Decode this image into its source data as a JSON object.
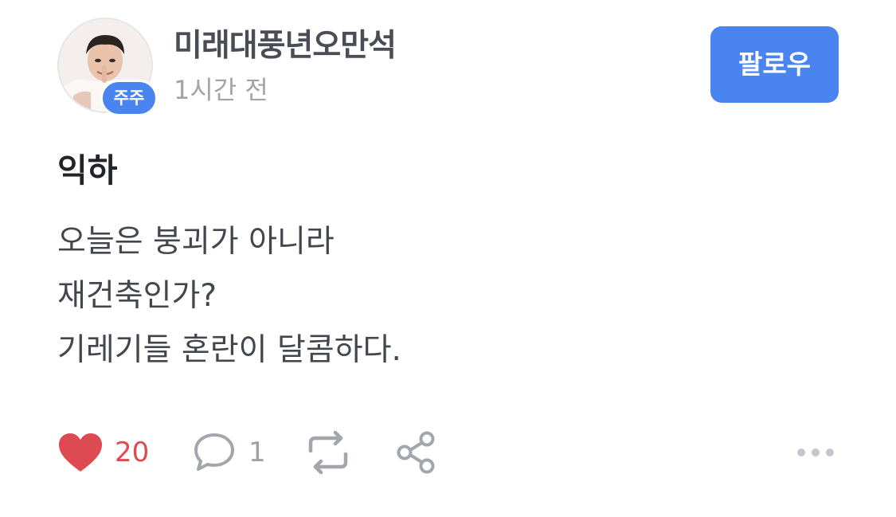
{
  "author": {
    "name": "미래대풍년오만석",
    "badge": "주주",
    "avatar_icon": "avatar-photo",
    "time": "1시간 전"
  },
  "follow_button": {
    "label": "팔로우"
  },
  "post": {
    "title": "익하",
    "body_lines": [
      "오늘은 붕괴가 아니라",
      "재건축인가?",
      "기레기들 혼란이 달콤하다."
    ]
  },
  "actions": {
    "like": {
      "icon": "heart-icon",
      "count": "20",
      "color": "#dd4a52"
    },
    "comment": {
      "icon": "comment-icon",
      "count": "1"
    },
    "repost": {
      "icon": "repost-icon"
    },
    "share": {
      "icon": "share-icon"
    },
    "more": {
      "icon": "more-icon"
    }
  },
  "colors": {
    "accent": "#4a84f0",
    "like": "#dd4a52",
    "muted": "#9ea1a7"
  }
}
